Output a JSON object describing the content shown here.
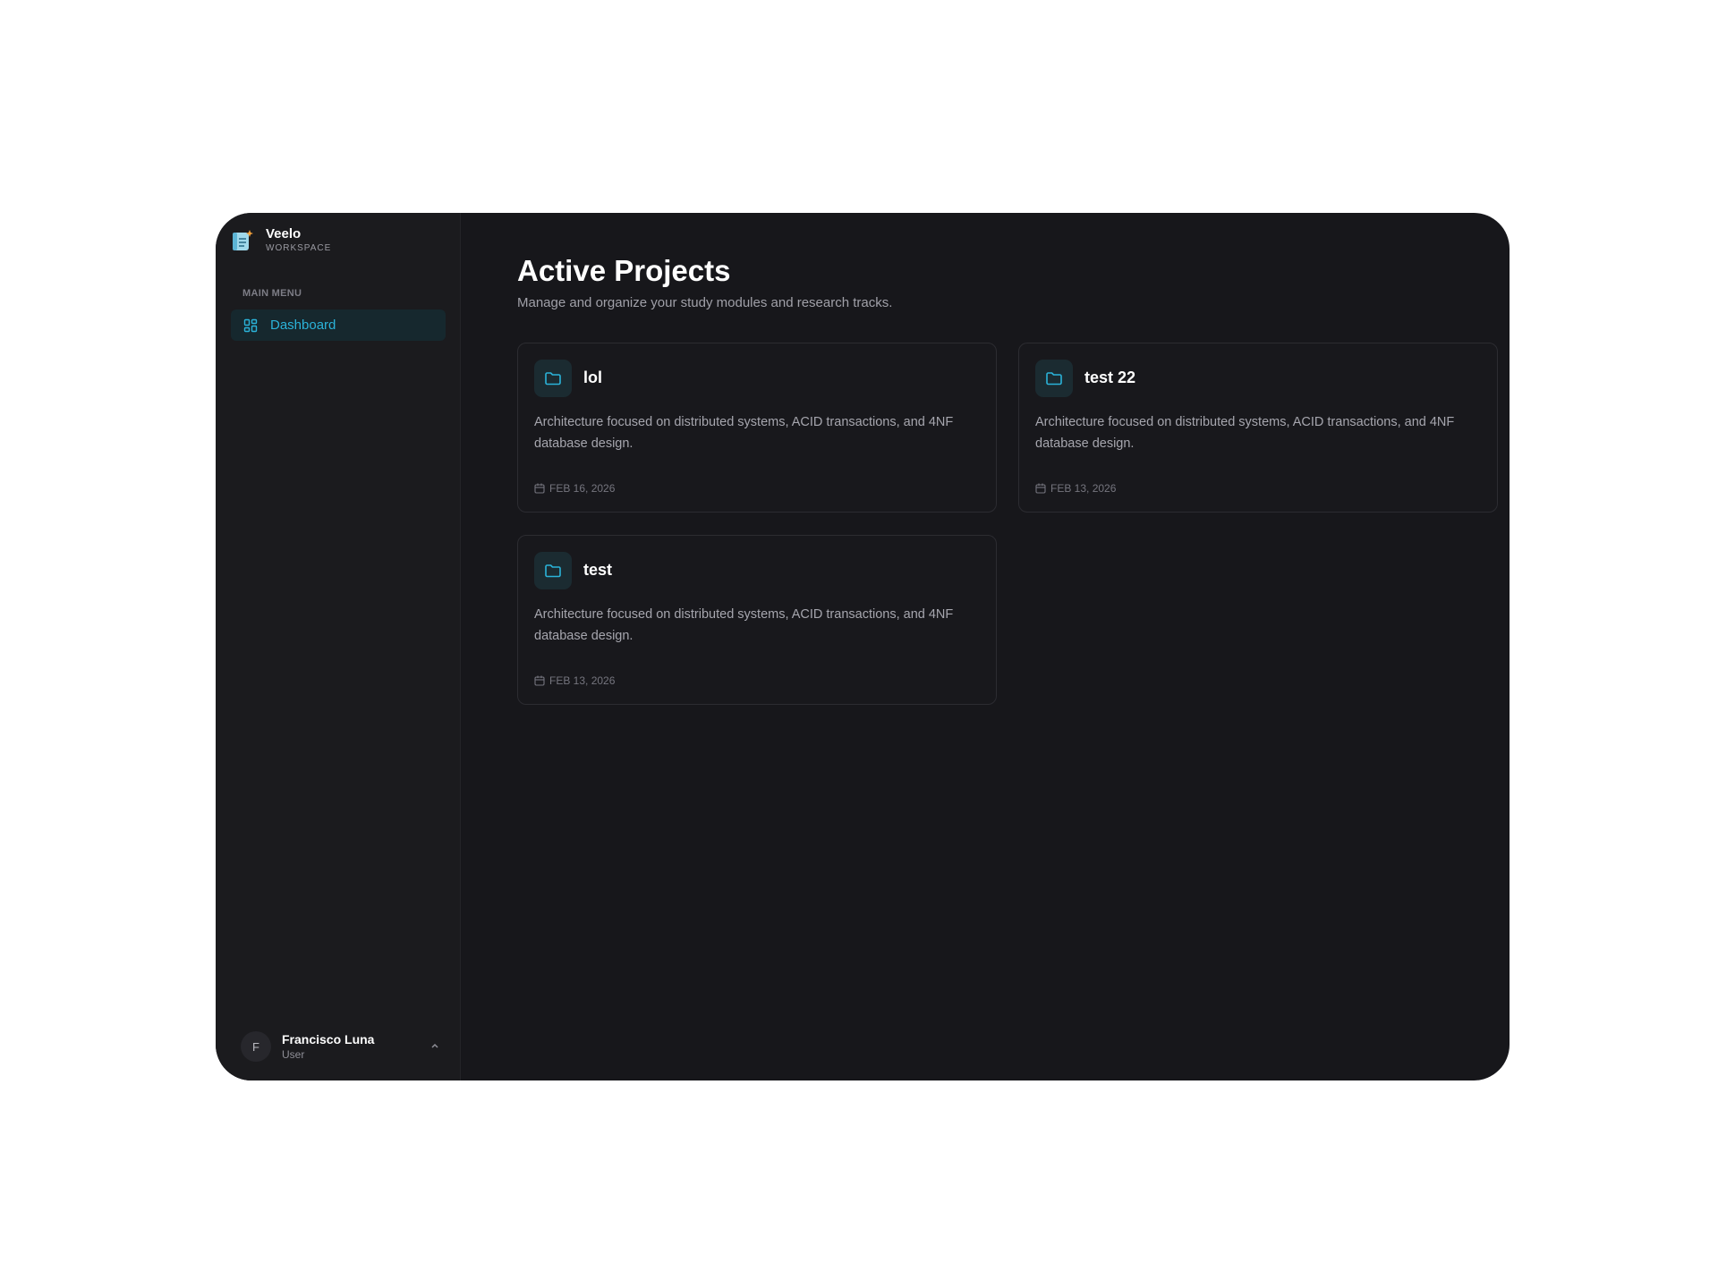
{
  "brand": {
    "name": "Veelo",
    "subtitle": "WORKSPACE"
  },
  "sidebar": {
    "menu_heading": "MAIN MENU",
    "items": [
      {
        "label": "Dashboard",
        "icon": "dashboard-grid-icon",
        "active": true
      }
    ]
  },
  "user": {
    "initial": "F",
    "name": "Francisco Luna",
    "role": "User"
  },
  "main": {
    "title": "Active Projects",
    "subtitle": "Manage and organize your study modules and research tracks."
  },
  "projects": [
    {
      "title": "lol",
      "description": "Architecture focused on distributed systems, ACID transactions, and 4NF database design.",
      "date": "FEB 16, 2026"
    },
    {
      "title": "test 22",
      "description": "Architecture focused on distributed systems, ACID transactions, and 4NF database design.",
      "date": "FEB 13, 2026"
    },
    {
      "title": "test",
      "description": "Architecture focused on distributed systems, ACID transactions, and 4NF database design.",
      "date": "FEB 13, 2026"
    }
  ],
  "colors": {
    "accent": "#2bb3d9",
    "background": "#17171b",
    "sidebar": "#1b1b1e",
    "card_border": "#2c2c31"
  }
}
